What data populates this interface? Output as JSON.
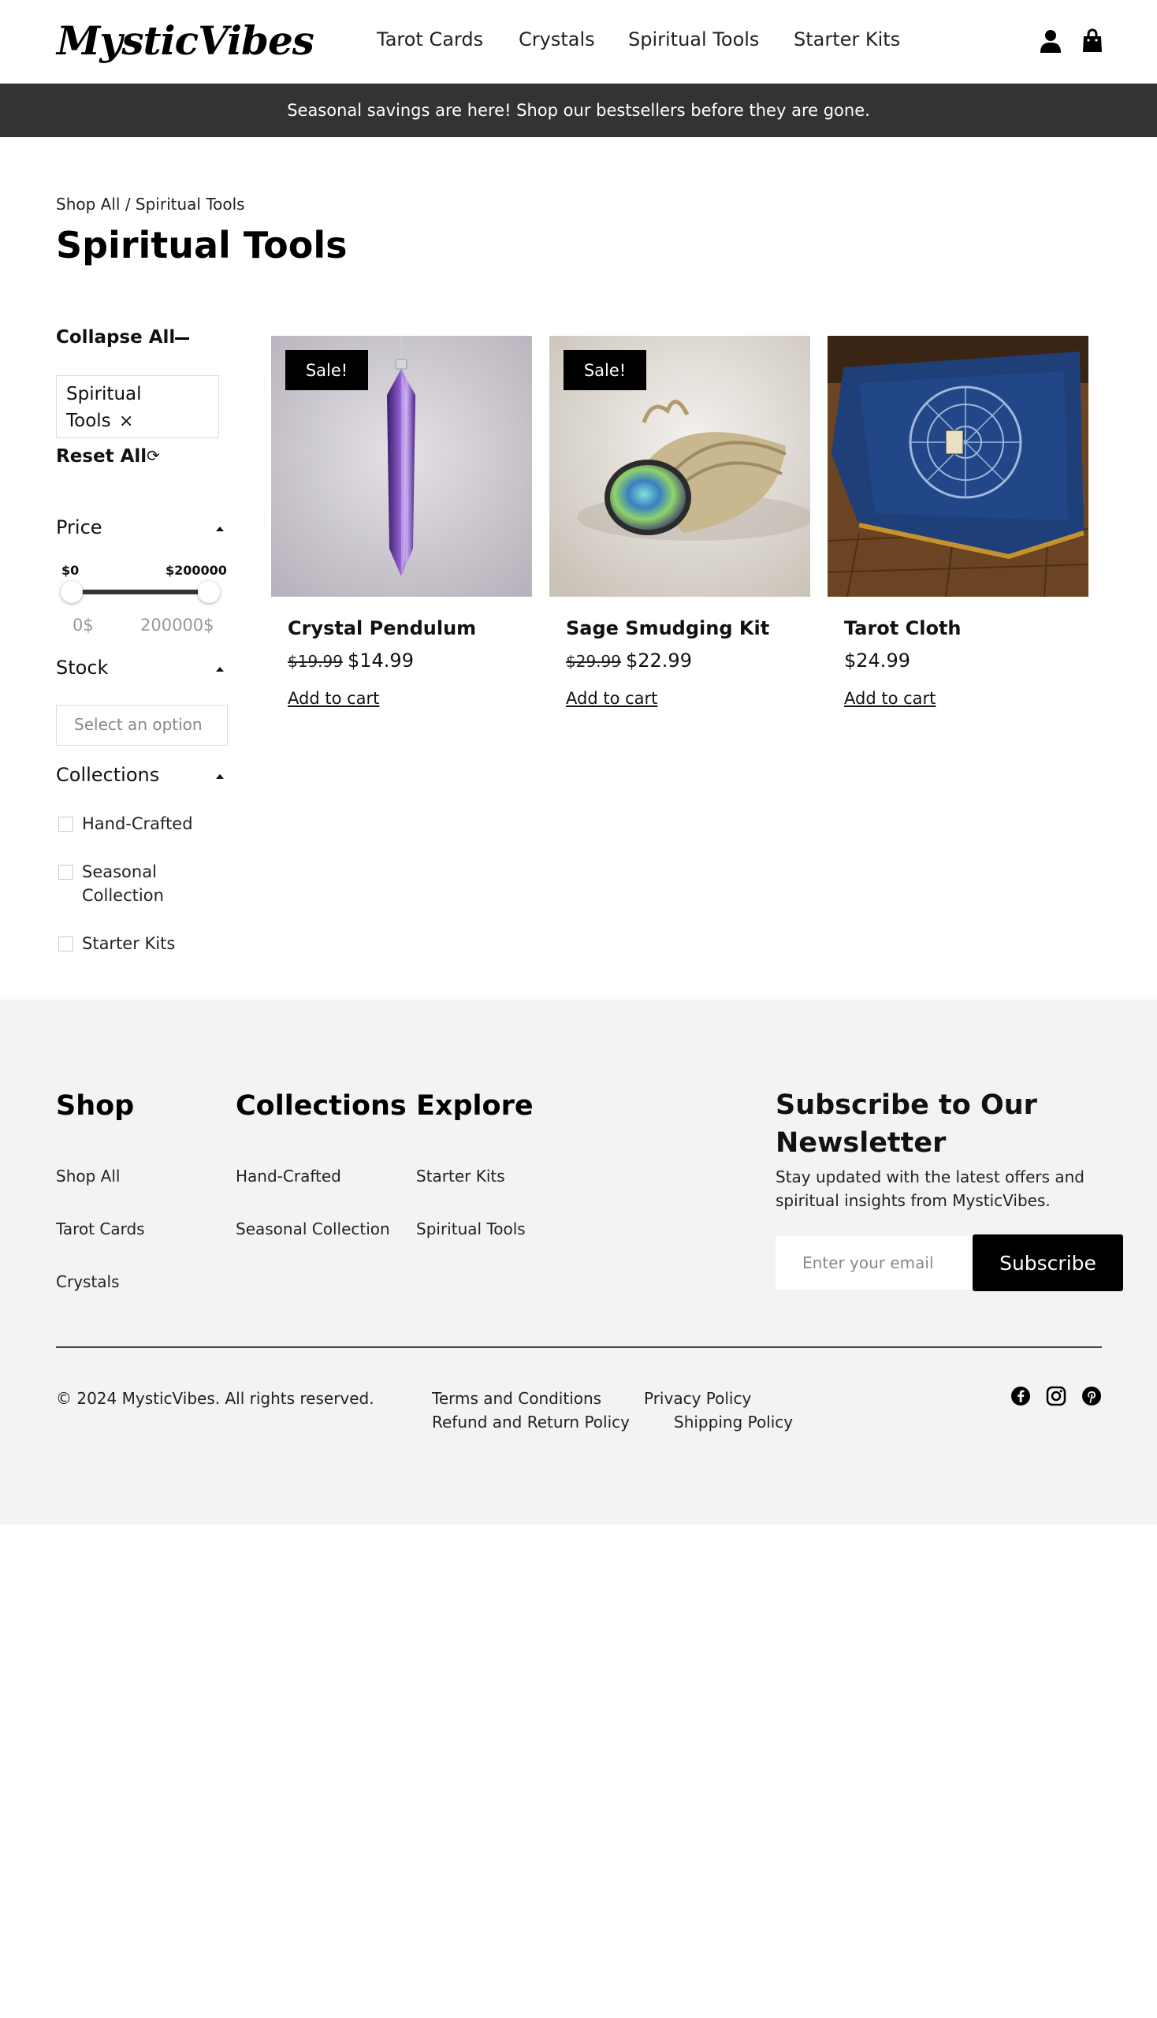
{
  "brand": {
    "name": "MysticVibes"
  },
  "nav": {
    "items": [
      "Tarot Cards",
      "Crystals",
      "Spiritual Tools",
      "Starter Kits"
    ]
  },
  "header_icons": [
    "user-icon",
    "shopping-bag-icon"
  ],
  "announcement": "Seasonal savings are here! Shop our bestsellers before they are gone.",
  "breadcrumb": "Shop All / Spiritual Tools",
  "page_title": "Spiritual Tools",
  "sidebar": {
    "collapse_all": "Collapse All",
    "active_filter": "Spiritual Tools",
    "active_filter_remove": "×",
    "reset_all": "Reset All",
    "price": {
      "title": "Price",
      "min_label": "$0",
      "max_label": "$200000",
      "min_input": "0$",
      "max_input": "200000$",
      "range": [
        0,
        200000
      ],
      "selected": [
        0,
        200000
      ]
    },
    "stock": {
      "title": "Stock",
      "placeholder": "Select an option"
    },
    "collections": {
      "title": "Collections",
      "options": [
        {
          "label": "Hand-Crafted",
          "checked": false
        },
        {
          "label": "Seasonal Collection",
          "checked": false
        },
        {
          "label": "Starter Kits",
          "checked": false
        }
      ]
    }
  },
  "products": [
    {
      "name": "Crystal Pendulum",
      "badge": "Sale!",
      "old_price": "$19.99",
      "price": "$14.99",
      "cta": "Add to cart"
    },
    {
      "name": "Sage Smudging Kit",
      "badge": "Sale!",
      "old_price": "$29.99",
      "price": "$22.99",
      "cta": "Add to cart"
    },
    {
      "name": "Tarot Cloth",
      "badge": "",
      "old_price": "",
      "price": "$24.99",
      "cta": "Add to cart"
    }
  ],
  "footer": {
    "shop": {
      "title": "Shop",
      "links": [
        "Shop All",
        "Tarot Cards",
        "Crystals"
      ]
    },
    "collections": {
      "title": "Collections",
      "links": [
        "Hand-Crafted",
        "Seasonal Collection"
      ]
    },
    "explore": {
      "title": "Explore",
      "links": [
        "Starter Kits",
        "Spiritual Tools"
      ]
    },
    "newsletter": {
      "title": "Subscribe to Our Newsletter",
      "description": "Stay updated with the latest offers and spiritual insights from MysticVibes.",
      "placeholder": "Enter your email",
      "button": "Subscribe"
    },
    "copyright": "© 2024 MysticVibes. All rights reserved.",
    "legal_links": [
      "Terms and Conditions",
      "Privacy Policy",
      "Refund and Return Policy",
      "Shipping Policy"
    ],
    "social_icons": [
      "facebook-icon",
      "instagram-icon",
      "pinterest-icon"
    ]
  }
}
